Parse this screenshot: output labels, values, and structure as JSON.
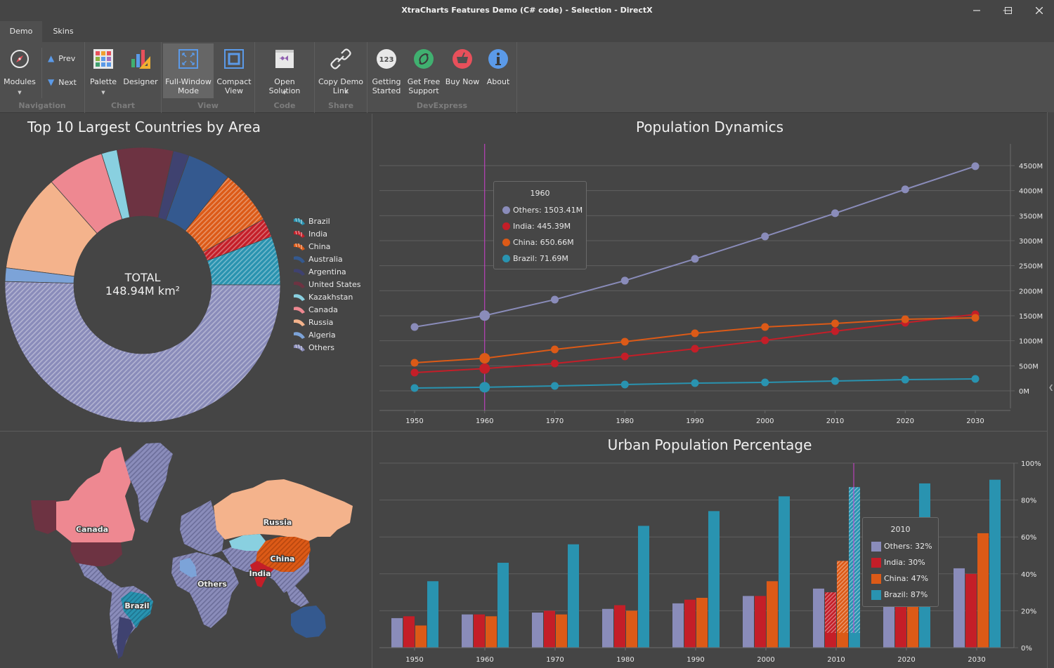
{
  "window": {
    "title": "XtraCharts Features Demo (C# code) - Selection - DirectX",
    "controls": [
      "minimize",
      "maximize",
      "close"
    ]
  },
  "tabs": [
    {
      "label": "Demo",
      "active": true
    },
    {
      "label": "Skins",
      "active": false
    }
  ],
  "ribbon": {
    "groups": [
      {
        "label": "Navigation",
        "items": [
          {
            "label": "Modules",
            "icon": "compass-icon",
            "dropdown": true
          },
          {
            "label": "Prev",
            "icon": "triangle-up-icon"
          },
          {
            "label": "Next",
            "icon": "triangle-down-icon"
          }
        ]
      },
      {
        "label": "Chart",
        "items": [
          {
            "label": "Palette",
            "icon": "palette-grid-icon",
            "dropdown": true
          },
          {
            "label": "Designer",
            "icon": "chart-designer-icon"
          }
        ]
      },
      {
        "label": "View",
        "items": [
          {
            "label": "Full-Window\nMode",
            "icon": "fullscreen-icon",
            "selected": true
          },
          {
            "label": "Compact\nView",
            "icon": "compact-view-icon"
          }
        ]
      },
      {
        "label": "Code",
        "items": [
          {
            "label": "Open Solution",
            "icon": "visual-studio-icon",
            "dropdown": true
          }
        ]
      },
      {
        "label": "Share",
        "items": [
          {
            "label": "Copy Demo\nLink",
            "icon": "link-icon",
            "dropdown": true
          }
        ]
      },
      {
        "label": "DevExpress",
        "items": [
          {
            "label": "Getting\nStarted",
            "icon": "123-icon"
          },
          {
            "label": "Get Free\nSupport",
            "icon": "support-icon"
          },
          {
            "label": "Buy Now",
            "icon": "basket-icon"
          },
          {
            "label": "About",
            "icon": "info-icon"
          }
        ]
      }
    ]
  },
  "colors": {
    "others": "#8a8cba",
    "india": "#c41e28",
    "china": "#dc5a17",
    "brazil": "#2993b0",
    "australia": "#34598f",
    "argentina": "#3f4270",
    "united_states": "#6d3342",
    "kazakhstan": "#89d0e0",
    "canada": "#ee8891",
    "russia": "#f4b38c",
    "algeria": "#7ca3d8",
    "crosshair": "#d040d0",
    "background": "#454545",
    "grid": "#5f5f5f"
  },
  "chart_data": [
    {
      "type": "pie",
      "title": "Top 10 Largest Countries by Area",
      "center_label": "TOTAL",
      "center_value": "148.94M km²",
      "donut": true,
      "legend_position": "right",
      "slices": [
        {
          "name": "Brazil",
          "value": 8.52,
          "color": "#2993b0",
          "hatched": true
        },
        {
          "name": "India",
          "value": 3.29,
          "color": "#c41e28",
          "hatched": true
        },
        {
          "name": "China",
          "value": 9.6,
          "color": "#dc5a17",
          "hatched": true
        },
        {
          "name": "Australia",
          "value": 7.69,
          "color": "#34598f",
          "hatched": false
        },
        {
          "name": "Argentina",
          "value": 2.78,
          "color": "#3f4270",
          "hatched": false
        },
        {
          "name": "United States",
          "value": 9.83,
          "color": "#6d3342",
          "hatched": false
        },
        {
          "name": "Kazakhstan",
          "value": 2.72,
          "color": "#89d0e0",
          "hatched": false
        },
        {
          "name": "Canada",
          "value": 9.98,
          "color": "#ee8891",
          "hatched": false
        },
        {
          "name": "Russia",
          "value": 17.1,
          "color": "#f4b38c",
          "hatched": false
        },
        {
          "name": "Algeria",
          "value": 2.38,
          "color": "#7ca3d8",
          "hatched": false
        },
        {
          "name": "Others",
          "value": 75.05,
          "color": "#8a8cba",
          "hatched": true
        }
      ]
    },
    {
      "type": "line",
      "title": "Population Dynamics",
      "x": [
        1950,
        1960,
        1970,
        1980,
        1990,
        2000,
        2010,
        2020,
        2030
      ],
      "ylim": [
        0,
        4500
      ],
      "yticks": [
        "0M",
        "500M",
        "1000M",
        "1500M",
        "2000M",
        "2500M",
        "3000M",
        "3500M",
        "4000M",
        "4500M"
      ],
      "ytick_values": [
        0,
        500,
        1000,
        1500,
        2000,
        2500,
        3000,
        3500,
        4000,
        4500
      ],
      "y_axis_position": "right",
      "grid": true,
      "series": [
        {
          "name": "Others",
          "color": "#8a8cba",
          "values": [
            1276,
            1503.41,
            1823,
            2202,
            2637,
            3085,
            3548,
            4025,
            4488
          ]
        },
        {
          "name": "India",
          "color": "#c41e28",
          "values": [
            365,
            445.39,
            547,
            687,
            841,
            1010,
            1192,
            1360,
            1528
          ]
        },
        {
          "name": "China",
          "color": "#dc5a17",
          "values": [
            561,
            650.66,
            827,
            982,
            1150,
            1276,
            1346,
            1430,
            1458
          ]
        },
        {
          "name": "Brazil",
          "color": "#2993b0",
          "values": [
            56,
            71.69,
            98,
            126,
            154,
            168,
            196,
            224,
            238
          ]
        }
      ],
      "crosshair_x": 1960,
      "tooltip": {
        "title": "1960",
        "rows": [
          "Others: 1503.41M",
          "India: 445.39M",
          "China: 650.66M",
          "Brazil: 71.69M"
        ]
      }
    },
    {
      "type": "bar",
      "title": "Urban Population Percentage",
      "categories": [
        "1950",
        "1960",
        "1970",
        "1980",
        "1990",
        "2000",
        "2010",
        "2020",
        "2030"
      ],
      "ylim": [
        0,
        100
      ],
      "yticks": [
        "0%",
        "20%",
        "40%",
        "60%",
        "80%",
        "100%"
      ],
      "ytick_values": [
        0,
        20,
        40,
        60,
        80,
        100
      ],
      "y_axis_position": "right",
      "grid": true,
      "series": [
        {
          "name": "Others",
          "color": "#8a8cba",
          "values": [
            16,
            18,
            19,
            21,
            24,
            28,
            32,
            36,
            43
          ]
        },
        {
          "name": "India",
          "color": "#c41e28",
          "values": [
            17,
            18,
            20,
            23,
            26,
            28,
            30,
            35,
            40
          ]
        },
        {
          "name": "China",
          "color": "#dc5a17",
          "values": [
            12,
            17,
            18,
            20,
            27,
            36,
            47,
            57,
            62
          ]
        },
        {
          "name": "Brazil",
          "color": "#2993b0",
          "values": [
            36,
            46,
            56,
            66,
            74,
            82,
            87,
            89,
            91
          ]
        }
      ],
      "crosshair_category": "2010",
      "tooltip": {
        "title": "2010",
        "rows": [
          "Others: 32%",
          "India: 30%",
          "China: 47%",
          "Brazil: 87%"
        ]
      }
    }
  ],
  "map": {
    "labels": [
      "Canada",
      "Russia",
      "China",
      "India",
      "Others",
      "Brazil"
    ]
  }
}
